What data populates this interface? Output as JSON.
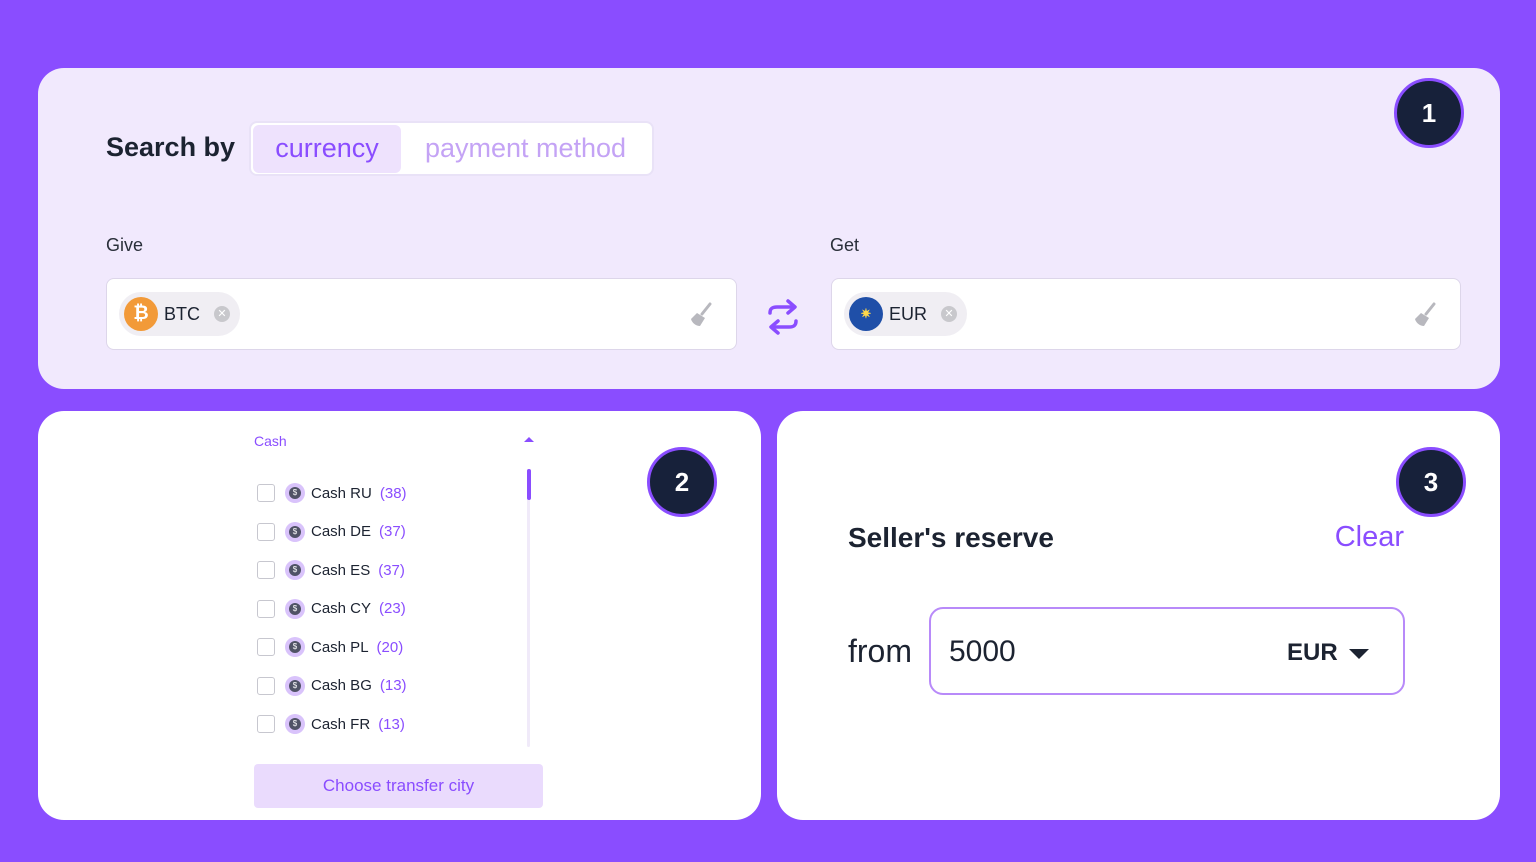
{
  "badges": [
    "1",
    "2",
    "3"
  ],
  "search": {
    "label": "Search by",
    "tabs": [
      "currency",
      "payment method"
    ]
  },
  "give": {
    "label": "Give",
    "currency": "BTC",
    "icon_glyph": "₿"
  },
  "get": {
    "label": "Get",
    "currency": "EUR",
    "icon_glyph": "✷"
  },
  "cash": {
    "header": "Cash",
    "items": [
      {
        "name": "Cash RU",
        "count": "(38)"
      },
      {
        "name": "Cash DE",
        "count": "(37)"
      },
      {
        "name": "Cash ES",
        "count": "(37)"
      },
      {
        "name": "Cash CY",
        "count": "(23)"
      },
      {
        "name": "Cash PL",
        "count": "(20)"
      },
      {
        "name": "Cash BG",
        "count": "(13)"
      },
      {
        "name": "Cash FR",
        "count": "(13)"
      }
    ],
    "button": "Choose transfer city"
  },
  "reserve": {
    "title": "Seller's reserve",
    "clear": "Clear",
    "from_label": "from",
    "amount": "5000",
    "currency": "EUR"
  },
  "colors": {
    "background": "#8a4dff",
    "accent": "#8a4dff",
    "badge": "#17213a",
    "btc": "#f29a38",
    "eur": "#1f4fa8"
  }
}
